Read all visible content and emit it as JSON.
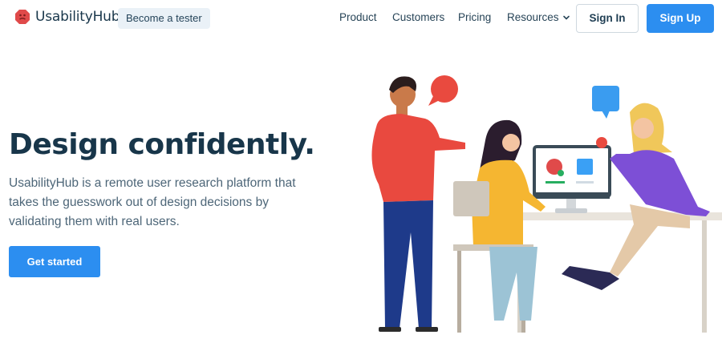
{
  "header": {
    "brand": "UsabilityHub",
    "tester_link": "Become a tester",
    "nav": [
      {
        "label": "Product"
      },
      {
        "label": "Customers"
      },
      {
        "label": "Pricing"
      },
      {
        "label": "Resources"
      }
    ],
    "signin": "Sign In",
    "signup": "Sign Up"
  },
  "hero": {
    "title": "Design confidently.",
    "subtitle": "UsabilityHub is a remote user research platform that takes the guesswork out of design decisions by validating them with real users.",
    "cta": "Get started"
  },
  "colors": {
    "brand_red": "#e04a4a",
    "primary_blue": "#2c8ef0",
    "heading": "#18364a",
    "pill_bg": "#eaf1f7"
  },
  "icons": {
    "logo": "usabilityhub-logo-icon",
    "resources_dropdown": "chevron-down-icon"
  }
}
